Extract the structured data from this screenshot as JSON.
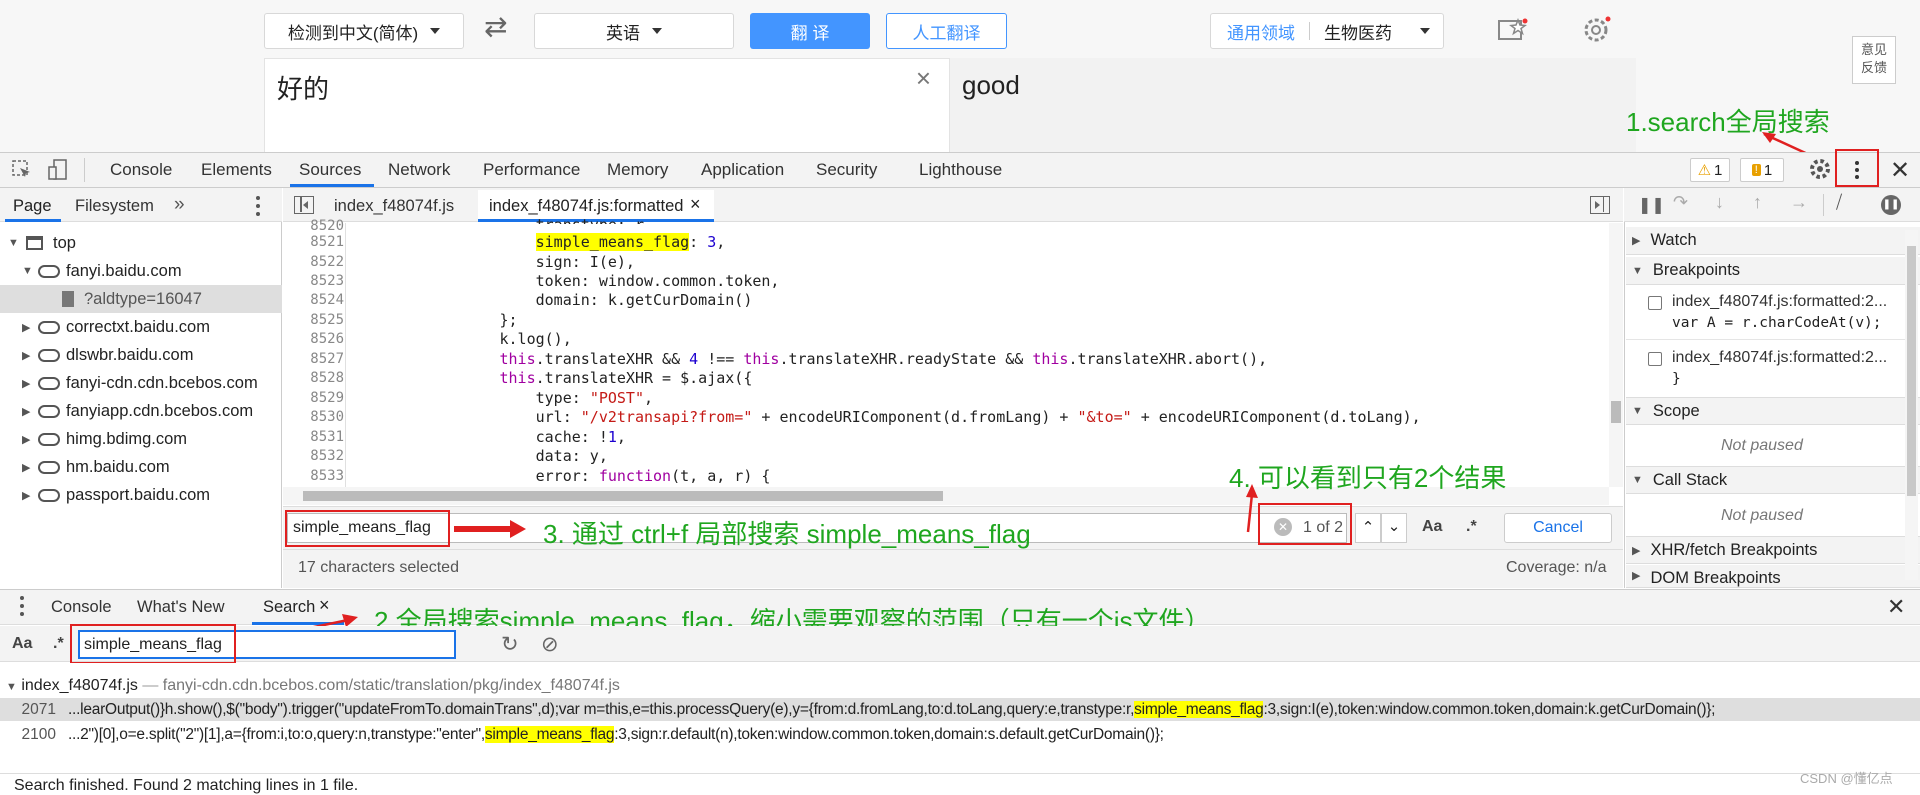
{
  "translate": {
    "source_lang": "检测到中文(简体)",
    "swap": "⇄",
    "target_lang": "英语",
    "translate_btn": "翻 译",
    "human_btn": "人工翻译",
    "domain_label": "通用领域",
    "domain_value": "生物医药",
    "feedback_line1": "意见",
    "feedback_line2": "反馈",
    "input_text": "好的",
    "clear": "×",
    "output_text": "good"
  },
  "annotations": {
    "a1": "1.search全局搜索",
    "a2": "2.全局搜索simple_means_flag，缩小需要观察的范围（只有一个js文件）",
    "a3": "3. 通过 ctrl+f 局部搜索 simple_means_flag",
    "a4": "4. 可以看到只有2个结果"
  },
  "devtools": {
    "tabs": [
      "Console",
      "Elements",
      "Sources",
      "Network",
      "Performance",
      "Memory",
      "Application",
      "Security",
      "Lighthouse"
    ],
    "warn_count": "1",
    "issue_count": "1",
    "sidebar_tabs": [
      "Page",
      "Filesystem",
      "»"
    ],
    "tree": {
      "top": "top",
      "items": [
        "fanyi.baidu.com",
        "?aldtype=16047",
        "correctxt.baidu.com",
        "dlswbr.baidu.com",
        "fanyi-cdn.cdn.bcebos.com",
        "fanyiapp.cdn.bcebos.com",
        "himg.bdimg.com",
        "hm.baidu.com",
        "passport.baidu.com"
      ]
    },
    "editor_tabs": [
      "index_f48074f.js",
      "index_f48074f.js:formatted"
    ],
    "editor_tab_close": "×",
    "lines": [
      "8520",
      "8521",
      "8522",
      "8523",
      "8524",
      "8525",
      "8526",
      "8527",
      "8528",
      "8529",
      "8530",
      "8531",
      "8532",
      "8533"
    ],
    "find": {
      "query": "simple_means_flag",
      "count": "1 of 2",
      "aa": "Aa",
      "regex": ".*",
      "cancel": "Cancel"
    },
    "status": {
      "selected": "17 characters selected",
      "coverage": "Coverage: n/a"
    },
    "right": {
      "watch": "Watch",
      "breakpoints": "Breakpoints",
      "bp1_file": "index_f48074f.js:formatted:2...",
      "bp1_code": "var A = r.charCodeAt(v);",
      "bp2_file": "index_f48074f.js:formatted:2...",
      "bp2_code": "}",
      "scope": "Scope",
      "not_paused1": "Not paused",
      "callstack": "Call Stack",
      "not_paused2": "Not paused",
      "xhr": "XHR/fetch Breakpoints",
      "dom": "DOM Breakpoints"
    },
    "drawer": {
      "tabs": [
        "Console",
        "What's New",
        "Search"
      ],
      "search_close": "×",
      "aa": "Aa",
      "regex": ".*",
      "query": "simple_means_flag"
    },
    "results": {
      "file": "index_f48074f.js",
      "path": "fanyi-cdn.cdn.bcebos.com/static/translation/pkg/index_f48074f.js",
      "r1_line": "2071",
      "r1_pre": "...learOutput()}h.show(),$(\"body\").trigger(\"updateFromTo.domainTrans\",d);var m=this,e=this.processQuery(e),y={from:d.fromLang,to:d.toLang,query:e,transtype:r,",
      "r1_hl": "simple_means_flag",
      "r1_post": ":3,sign:I(e),token:window.common.token,domain:k.getCurDomain()};",
      "r2_line": "2100",
      "r2_pre": "...2\")[0],o=e.split(\"2\")[1],a={from:i,to:o,query:n,transtype:\"enter\",",
      "r2_hl": "simple_means_flag",
      "r2_post": ":3,sign:r.default(n),token:window.common.token,domain:s.default.getCurDomain()};",
      "summary": "Search finished.  Found 2 matching lines in 1 file.",
      "watermark": "CSDN @懂亿点"
    }
  },
  "colors": {
    "accent": "#1a73e8",
    "annot": "#1fa61f",
    "red": "#e02020",
    "highlight": "#ffff00"
  }
}
